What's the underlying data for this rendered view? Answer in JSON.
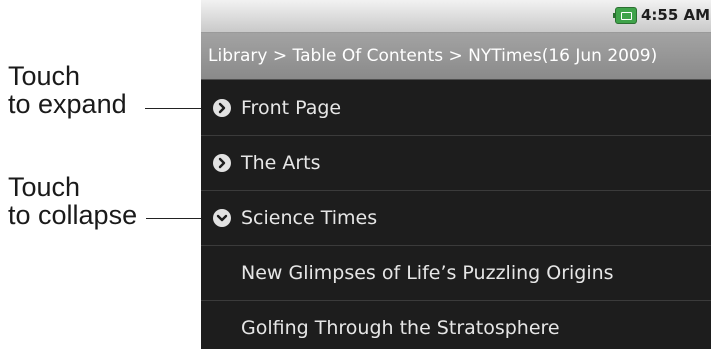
{
  "annotations": {
    "expand": {
      "line1": "Touch",
      "line2": "to expand"
    },
    "collapse": {
      "line1": "Touch",
      "line2": "to collapse"
    }
  },
  "status_bar": {
    "time": "4:55 AM",
    "icons": [
      "battery-charging-icon"
    ]
  },
  "breadcrumb": "Library > Table Of Contents > NYTimes(16 Jun 2009)",
  "toc": [
    {
      "label": "Front Page",
      "state": "collapsed",
      "icon": "chevron-right-circle-icon"
    },
    {
      "label": "The Arts",
      "state": "collapsed",
      "icon": "chevron-right-circle-icon"
    },
    {
      "label": "Science Times",
      "state": "expanded",
      "icon": "chevron-down-circle-icon"
    },
    {
      "label": "New Glimpses of Life’s Puzzling Origins",
      "state": "child"
    },
    {
      "label": "Golfing Through the Stratosphere",
      "state": "child"
    }
  ],
  "colors": {
    "list_bg": "#1d1d1d",
    "breadcrumb_bg": "#959595",
    "status_bg": "#d8d8d8",
    "text": "#e6e6e6"
  }
}
